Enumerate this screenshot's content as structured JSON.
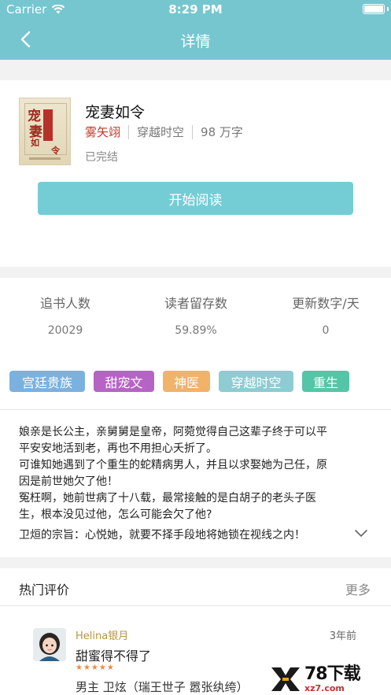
{
  "status_bar": {
    "carrier": "Carrier",
    "time": "8:29 PM",
    "battery_level": 1.0
  },
  "nav": {
    "title": "详情"
  },
  "book": {
    "title": "宠妻如令",
    "author": "雾矢翊",
    "category": "穿越时空",
    "word_count": "98 万字",
    "status": "已完结",
    "cover_text": "宠妻如令",
    "read_button": "开始阅读"
  },
  "stats": [
    {
      "label": "追书人数",
      "value": "20029"
    },
    {
      "label": "读者留存数",
      "value": "59.89%"
    },
    {
      "label": "更新数字/天",
      "value": "0"
    }
  ],
  "tags": [
    {
      "label": "宫廷贵族",
      "color": "#7bb1de"
    },
    {
      "label": "甜宠文",
      "color": "#b663c6"
    },
    {
      "label": "神医",
      "color": "#f1b26a"
    },
    {
      "label": "穿越时空",
      "color": "#8ecbd2"
    },
    {
      "label": "重生",
      "color": "#55c5a7"
    }
  ],
  "description": {
    "lines": [
      "娘亲是长公主，亲舅舅是皇帝，阿菀觉得自己这辈子终于可以平",
      "平安安地活到老，再也不用担心夭折了。",
      "可谁知她遇到了个重生的蛇精病男人，并且以求娶她为己任，原",
      "因是前世她欠了他！",
      "冤枉啊，她前世病了十八载，最常接触的是白胡子的老头子医",
      "生，根本没见过他，怎么可能会欠了他?"
    ],
    "motto": "卫烜的宗旨：心悦她，就要不择手段地将她锁在视线之内！"
  },
  "reviews": {
    "title": "热门评价",
    "more": "更多",
    "items": [
      {
        "user": "Helina银月",
        "time": "3年前",
        "text": "甜蜜得不得了",
        "stars": "★★★★★",
        "rating": 5,
        "extra": "男主 卫炫（瑞王世子 嚣张纨绔）"
      }
    ]
  },
  "watermark": {
    "main": "78下载",
    "sub": "xz7.com"
  }
}
